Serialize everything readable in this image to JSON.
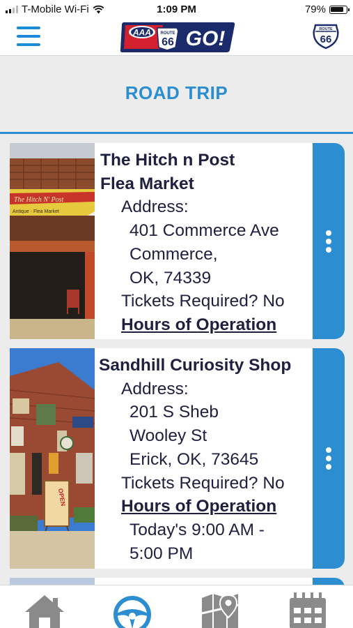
{
  "status_bar": {
    "carrier": "T-Mobile Wi-Fi",
    "time": "1:09 PM",
    "battery": "79%"
  },
  "header": {
    "logo_aaa": "AAA",
    "logo_route": "ROUTE",
    "logo_66": "66",
    "logo_go": "GO!",
    "shield_route": "ROUTE",
    "shield_number": "66"
  },
  "page": {
    "title": "ROAD TRIP"
  },
  "cards": [
    {
      "name_line1": "The Hitch n Post",
      "name_line2": "Flea Market",
      "address_label": "Address:",
      "address_line1": "401 Commerce Ave",
      "address_line2": "Commerce,",
      "address_line3": "OK, 74339",
      "tickets": "Tickets Required? No",
      "hours_link": "Hours of Operation",
      "photo_sign": "The Hitch N' Post",
      "photo_subsign": "Antique · Flea Market"
    },
    {
      "name_line1": "Sandhill Curiosity Shop",
      "address_label": "Address:",
      "address_line1": "201 S Sheb",
      "address_line2": "Wooley St",
      "address_line3": "Erick, OK, 73645",
      "tickets": "Tickets Required? No",
      "hours_link": "Hours of Operation",
      "today_line1": "Today's 9:00 AM -",
      "today_line2": "5:00 PM",
      "photo_sign": "OPEN"
    }
  ],
  "bottom_nav": [
    {
      "icon": "home-icon"
    },
    {
      "icon": "steering-wheel-icon",
      "active": true
    },
    {
      "icon": "map-pin-icon"
    },
    {
      "icon": "calendar-icon"
    }
  ],
  "colors": {
    "accent": "#2c8ed1",
    "text": "#1f1f3f",
    "inactive_icon": "#8a8a8a",
    "logo_red": "#d3202f",
    "logo_navy": "#1b2a6b"
  }
}
